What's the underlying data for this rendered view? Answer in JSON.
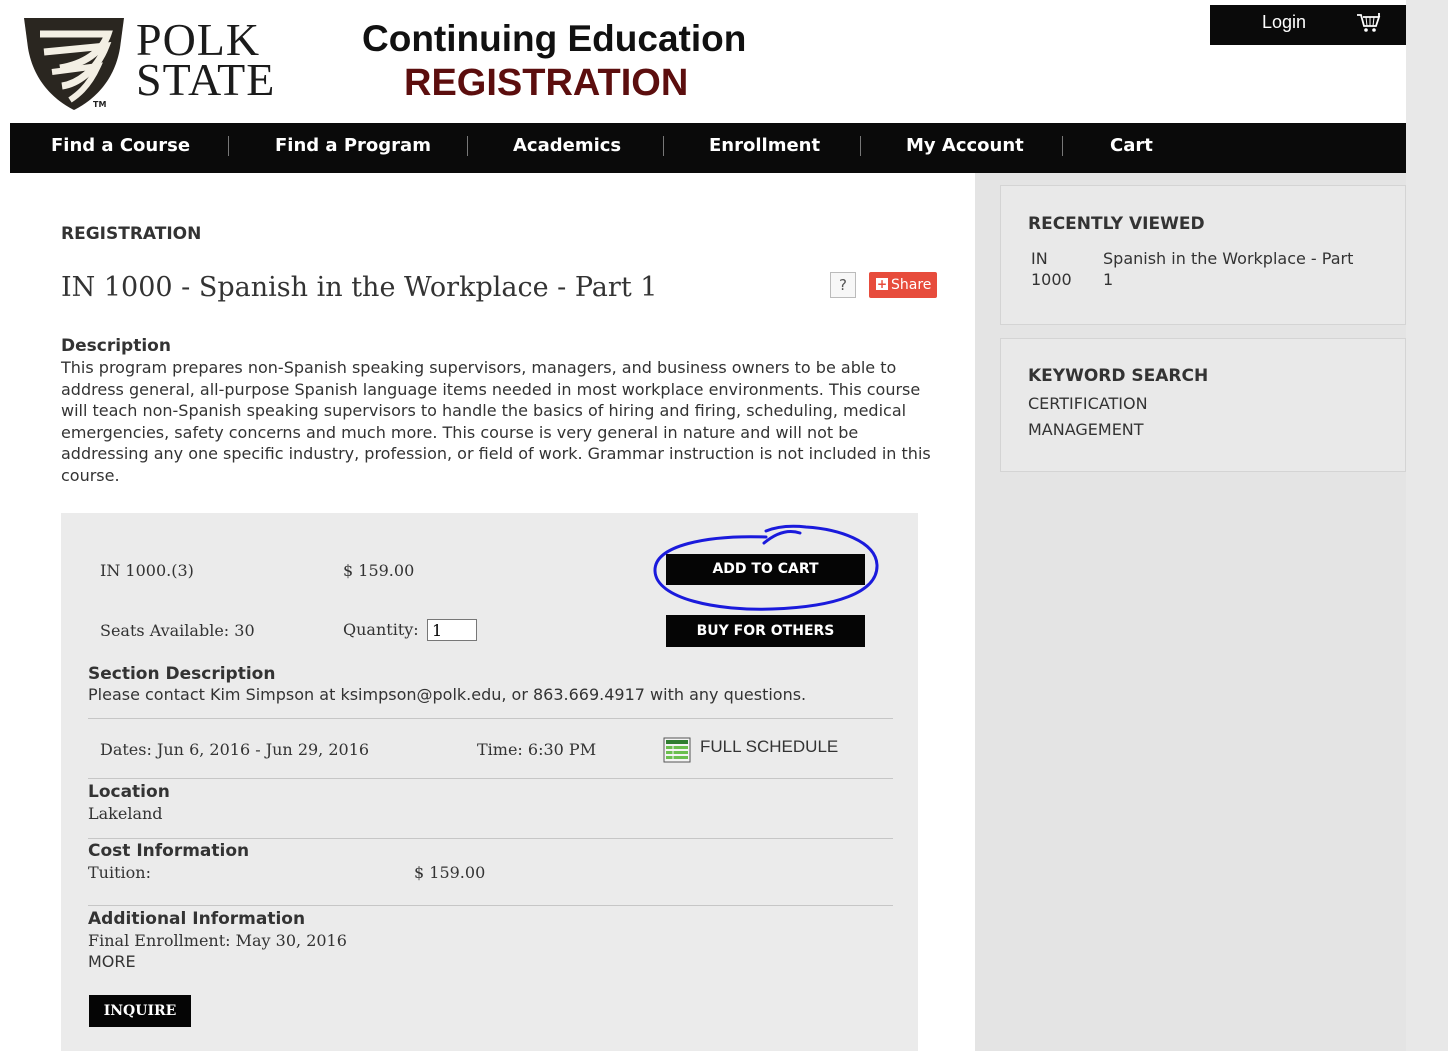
{
  "header": {
    "logo_text_line1": "POLK",
    "logo_text_line2": "STATE",
    "logo_tm": "TM",
    "site_title": "Continuing Education",
    "site_subtitle": "REGISTRATION",
    "login_label": "Login"
  },
  "nav": {
    "items": [
      "Find a Course",
      "Find a Program",
      "Academics",
      "Enrollment",
      "My Account",
      "Cart"
    ]
  },
  "main": {
    "section_heading": "REGISTRATION",
    "course_title": "IN 1000 - Spanish in the Workplace - Part 1",
    "help_label": "?",
    "share_label": "Share",
    "description_heading": "Description",
    "description_text": "This program prepares non-Spanish speaking supervisors, managers, and business owners to be able to address general, all-purpose Spanish language items needed in most workplace environments. This course will teach non-Spanish speaking supervisors to handle the basics of hiring and firing, scheduling, medical emergencies, safety concerns and much more. This course is very general in nature and will not be addressing any one specific industry, profession, or field of work. Grammar instruction is not included in this course."
  },
  "section": {
    "code": "IN 1000.(3)",
    "price": "$ 159.00",
    "add_to_cart_label": "ADD TO CART",
    "buy_for_others_label": "BUY FOR OTHERS",
    "seats_text": "Seats Available: 30",
    "quantity_label": "Quantity:",
    "quantity_value": "1",
    "section_description_heading": "Section Description",
    "section_description_text": "Please contact Kim Simpson at ksimpson@polk.edu, or 863.669.4917 with any questions.",
    "dates_text": "Dates: Jun 6, 2016 - Jun 29, 2016",
    "time_text": "Time: 6:30 PM",
    "full_schedule_label": "FULL SCHEDULE",
    "location_heading": "Location",
    "location_value": "Lakeland",
    "cost_heading": "Cost Information",
    "tuition_label": "Tuition:",
    "tuition_value": "$ 159.00",
    "additional_heading": "Additional Information",
    "final_enrollment_text": "Final Enrollment: May 30, 2016",
    "more_label": "MORE",
    "inquire_label": "INQUIRE"
  },
  "sidebar": {
    "recently_viewed_heading": "RECENTLY VIEWED",
    "recent_items": [
      {
        "code_line1": "IN",
        "code_line2": "1000",
        "title_line1": "Spanish in the Workplace - Part",
        "title_line2": "1"
      }
    ],
    "keyword_heading": "KEYWORD SEARCH",
    "keywords": [
      "CERTIFICATION",
      "MANAGEMENT"
    ]
  },
  "colors": {
    "nav_background": "#0a0a0a",
    "subtitle_red": "#5c0e0e",
    "share_red": "#e74c3c",
    "annotation_blue": "#1a1adc"
  }
}
